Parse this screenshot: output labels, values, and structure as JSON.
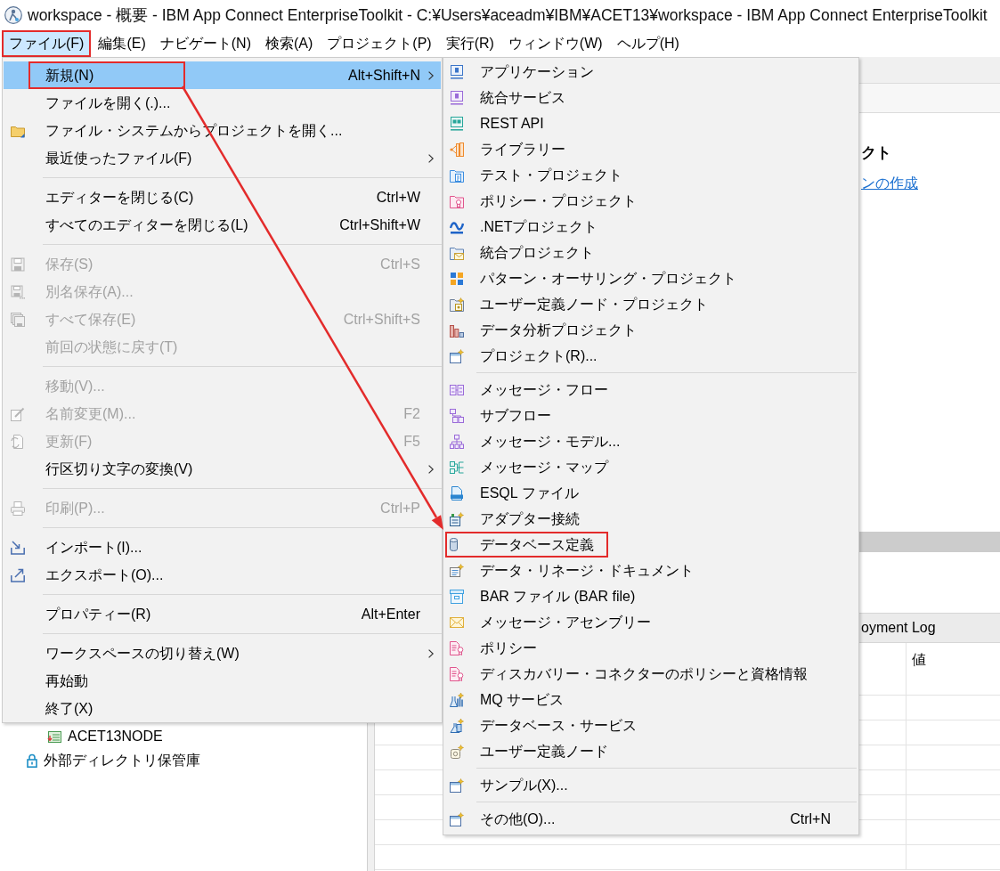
{
  "window": {
    "title": "workspace - 概要 - IBM App Connect EnterpriseToolkit - C:¥Users¥aceadm¥IBM¥ACET13¥workspace - IBM App Connect EnterpriseToolkit"
  },
  "menu_bar": [
    {
      "label": "ファイル(F)",
      "selected": true,
      "outlined": true
    },
    {
      "label": "編集(E)",
      "selected": false,
      "outlined": false
    },
    {
      "label": "ナビゲート(N)",
      "selected": false,
      "outlined": false
    },
    {
      "label": "検索(A)",
      "selected": false,
      "outlined": false
    },
    {
      "label": "プロジェクト(P)",
      "selected": false,
      "outlined": false
    },
    {
      "label": "実行(R)",
      "selected": false,
      "outlined": false
    },
    {
      "label": "ウィンドウ(W)",
      "selected": false,
      "outlined": false
    },
    {
      "label": "ヘルプ(H)",
      "selected": false,
      "outlined": false
    }
  ],
  "navigator": {
    "tree": [
      {
        "children": [
          {
            "label": "ACET13NODE"
          }
        ]
      },
      {
        "label": "外部ディレクトリ保管庫"
      }
    ]
  },
  "editor": {
    "heading": "クト",
    "link": "ンの作成"
  },
  "bottom_panel": {
    "tab": "oyment Log",
    "columns": [
      {
        "label": "値"
      }
    ]
  },
  "file_menu": {
    "items": [
      {
        "kind": "submenu",
        "label": "新規(N)",
        "shortcut": "Alt+Shift+N",
        "disabled": false,
        "selected": true,
        "outlined": true
      },
      {
        "kind": "command",
        "label": "ファイルを開く(.)...",
        "disabled": false,
        "selected": false,
        "outlined": false
      },
      {
        "kind": "command",
        "label": "ファイル・システムからプロジェクトを開く...",
        "disabled": false,
        "selected": false,
        "outlined": false
      },
      {
        "kind": "submenu",
        "label": "最近使ったファイル(F)",
        "disabled": false,
        "selected": false,
        "outlined": false
      },
      {
        "kind": "separator"
      },
      {
        "kind": "command",
        "label": "エディターを閉じる(C)",
        "shortcut": "Ctrl+W",
        "disabled": false,
        "selected": false,
        "outlined": false
      },
      {
        "kind": "command",
        "label": "すべてのエディターを閉じる(L)",
        "shortcut": "Ctrl+Shift+W",
        "disabled": false,
        "selected": false,
        "outlined": false
      },
      {
        "kind": "separator"
      },
      {
        "kind": "command",
        "label": "保存(S)",
        "shortcut": "Ctrl+S",
        "disabled": true,
        "selected": false,
        "outlined": false
      },
      {
        "kind": "command",
        "label": "別名保存(A)...",
        "disabled": true,
        "selected": false,
        "outlined": false
      },
      {
        "kind": "command",
        "label": "すべて保存(E)",
        "shortcut": "Ctrl+Shift+S",
        "disabled": true,
        "selected": false,
        "outlined": false
      },
      {
        "kind": "command",
        "label": "前回の状態に戻す(T)",
        "disabled": true,
        "selected": false,
        "outlined": false
      },
      {
        "kind": "separator"
      },
      {
        "kind": "command",
        "label": "移動(V)...",
        "disabled": true,
        "selected": false,
        "outlined": false
      },
      {
        "kind": "command",
        "label": "名前変更(M)...",
        "shortcut": "F2",
        "disabled": true,
        "selected": false,
        "outlined": false
      },
      {
        "kind": "command",
        "label": "更新(F)",
        "shortcut": "F5",
        "disabled": true,
        "selected": false,
        "outlined": false
      },
      {
        "kind": "submenu",
        "label": "行区切り文字の変換(V)",
        "disabled": false,
        "selected": false,
        "outlined": false
      },
      {
        "kind": "separator"
      },
      {
        "kind": "command",
        "label": "印刷(P)...",
        "shortcut": "Ctrl+P",
        "disabled": true,
        "selected": false,
        "outlined": false
      },
      {
        "kind": "separator"
      },
      {
        "kind": "command",
        "label": "インポート(I)...",
        "disabled": false,
        "selected": false,
        "outlined": false
      },
      {
        "kind": "command",
        "label": "エクスポート(O)...",
        "disabled": false,
        "selected": false,
        "outlined": false
      },
      {
        "kind": "separator"
      },
      {
        "kind": "command",
        "label": "プロパティー(R)",
        "shortcut": "Alt+Enter",
        "disabled": false,
        "selected": false,
        "outlined": false
      },
      {
        "kind": "separator"
      },
      {
        "kind": "submenu",
        "label": "ワークスペースの切り替え(W)",
        "disabled": false,
        "selected": false,
        "outlined": false
      },
      {
        "kind": "command",
        "label": "再始動",
        "disabled": false,
        "selected": false,
        "outlined": false
      },
      {
        "kind": "command",
        "label": "終了(X)",
        "disabled": false,
        "selected": false,
        "outlined": false
      }
    ]
  },
  "new_submenu": {
    "items": [
      {
        "kind": "command",
        "label": "アプリケーション",
        "outlined": false
      },
      {
        "kind": "command",
        "label": "統合サービス",
        "outlined": false
      },
      {
        "kind": "command",
        "label": "REST API",
        "outlined": false
      },
      {
        "kind": "command",
        "label": "ライブラリー",
        "outlined": false
      },
      {
        "kind": "command",
        "label": "テスト・プロジェクト",
        "outlined": false
      },
      {
        "kind": "command",
        "label": "ポリシー・プロジェクト",
        "outlined": false
      },
      {
        "kind": "command",
        "label": ".NETプロジェクト",
        "outlined": false
      },
      {
        "kind": "command",
        "label": "統合プロジェクト",
        "outlined": false
      },
      {
        "kind": "command",
        "label": "パターン・オーサリング・プロジェクト",
        "outlined": false
      },
      {
        "kind": "command",
        "label": "ユーザー定義ノード・プロジェクト",
        "outlined": false
      },
      {
        "kind": "command",
        "label": "データ分析プロジェクト",
        "outlined": false
      },
      {
        "kind": "command",
        "label": "プロジェクト(R)...",
        "outlined": false
      },
      {
        "kind": "separator"
      },
      {
        "kind": "command",
        "label": "メッセージ・フロー",
        "outlined": false
      },
      {
        "kind": "command",
        "label": "サブフロー",
        "outlined": false
      },
      {
        "kind": "command",
        "label": "メッセージ・モデル...",
        "outlined": false
      },
      {
        "kind": "command",
        "label": "メッセージ・マップ",
        "outlined": false
      },
      {
        "kind": "command",
        "label": "ESQL ファイル",
        "outlined": false
      },
      {
        "kind": "command",
        "label": "アダプター接続",
        "outlined": false
      },
      {
        "kind": "command",
        "label": "データベース定義",
        "outlined": true
      },
      {
        "kind": "command",
        "label": "データ・リネージ・ドキュメント",
        "outlined": false
      },
      {
        "kind": "command",
        "label": "BAR ファイル (BAR file)",
        "outlined": false
      },
      {
        "kind": "command",
        "label": "メッセージ・アセンブリー",
        "outlined": false
      },
      {
        "kind": "command",
        "label": "ポリシー",
        "outlined": false
      },
      {
        "kind": "command",
        "label": "ディスカバリー・コネクターのポリシーと資格情報",
        "outlined": false
      },
      {
        "kind": "command",
        "label": "MQ サービス",
        "outlined": false
      },
      {
        "kind": "command",
        "label": "データベース・サービス",
        "outlined": false
      },
      {
        "kind": "command",
        "label": "ユーザー定義ノード",
        "outlined": false
      },
      {
        "kind": "separator"
      },
      {
        "kind": "command",
        "label": "サンプル(X)...",
        "outlined": false
      },
      {
        "kind": "separator"
      },
      {
        "kind": "command",
        "label": "その他(O)...",
        "shortcut": "Ctrl+N",
        "outlined": false
      }
    ]
  }
}
